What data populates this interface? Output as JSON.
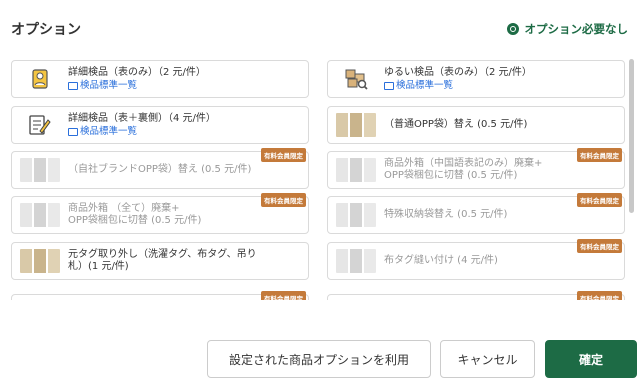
{
  "header": {
    "title": "オプション",
    "no_option_label": "オプション必要なし"
  },
  "options": [
    {
      "text": "詳細検品（表のみ）（2 元/件）",
      "link": "検品標準一覧",
      "icon": "id-card-icon",
      "badge": ""
    },
    {
      "text": "ゆるい検品（表のみ）（2 元/件）",
      "link": "検品標準一覧",
      "icon": "boxes-search-icon",
      "badge": ""
    },
    {
      "text": "詳細検品（表＋裏側）（4 元/件）",
      "link": "検品標準一覧",
      "icon": "edit-document-icon",
      "badge": ""
    },
    {
      "text": "（普通OPP袋）替え (0.5 元/件)",
      "link": "",
      "icon": "photo",
      "badge": ""
    },
    {
      "text": "（自社ブランドOPP袋）替え (0.5 元/件)",
      "link": "",
      "icon": "photo",
      "badge": "有料会員限定"
    },
    {
      "text": "商品外箱（中国語表記のみ）廃棄+",
      "text2": "OPP袋梱包に切替 (0.5 元/件)",
      "icon": "photo",
      "badge": "有料会員限定"
    },
    {
      "text": "商品外箱 （全て）廃棄+",
      "text2": "OPP袋梱包に切替 (0.5 元/件)",
      "icon": "photo",
      "badge": "有料会員限定"
    },
    {
      "text": "特殊収納袋替え (0.5 元/件)",
      "link": "",
      "icon": "photo",
      "badge": "有料会員限定"
    },
    {
      "text": "元タグ取り外し（洗濯タグ、布タグ、吊り",
      "text2": "札）(1 元/件)",
      "icon": "photo",
      "badge": ""
    },
    {
      "text": "布タグ縫い付け (4 元/件)",
      "link": "",
      "icon": "photo",
      "badge": "有料会員限定"
    },
    {
      "text": "",
      "icon": "photo",
      "badge": "有料会員限定"
    },
    {
      "text": "",
      "icon": "photo",
      "badge": "有料会員限定"
    }
  ],
  "buttons": {
    "use_saved": "設定された商品オプションを利用",
    "cancel": "キャンセル",
    "confirm": "確定"
  },
  "colors": {
    "primary": "#1d6b45",
    "badge": "#c47a3a",
    "link": "#2a6fdb"
  }
}
